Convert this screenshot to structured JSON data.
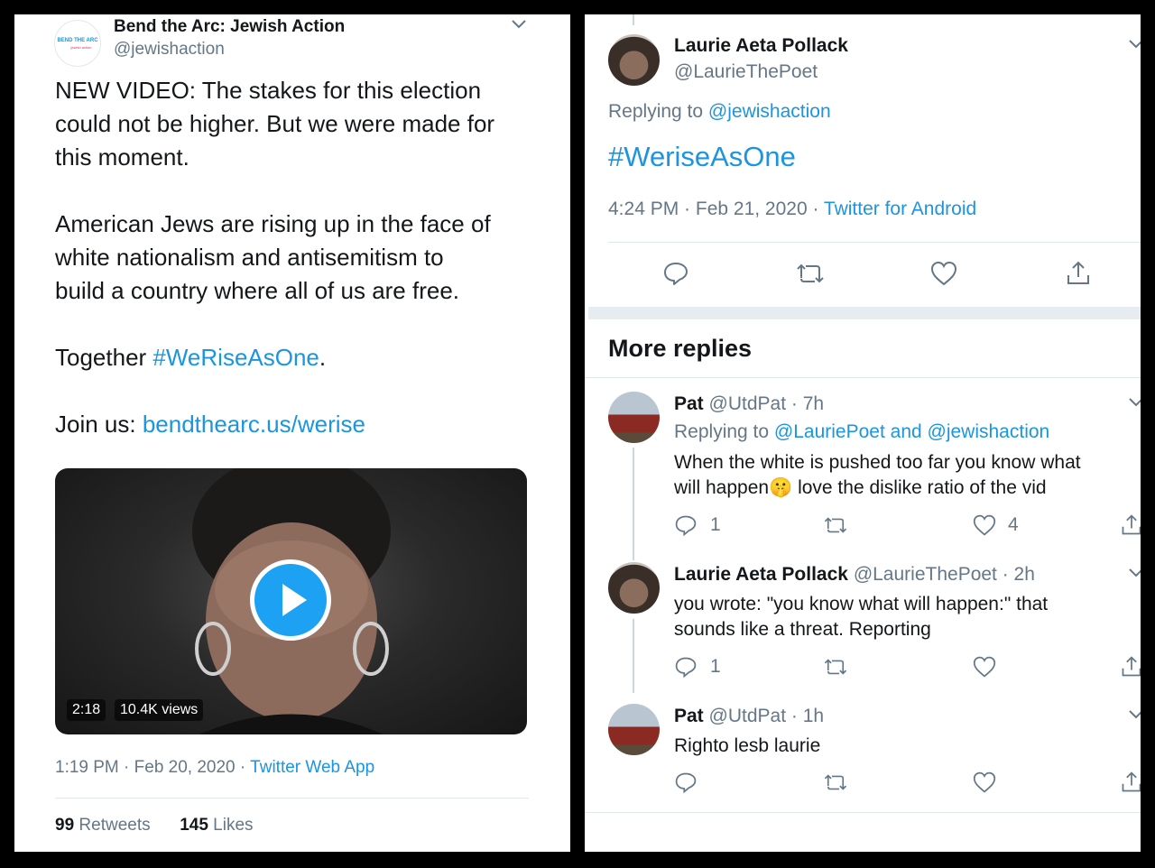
{
  "left_tweet": {
    "author_name": "Bend the Arc: Jewish Action",
    "author_handle": "@jewishaction",
    "avatar_logo_text": "BEND THE ARC",
    "avatar_logo_sub": "jewish action",
    "body_line1": "NEW VIDEO: The stakes for this election",
    "body_line2": "could not be higher. But we were made for",
    "body_line3": "this moment.",
    "body_line4": "American Jews are rising up in the face of",
    "body_line5": "white nationalism and antisemitism to",
    "body_line6": "build a country where all of us are free.",
    "together_text": "Together ",
    "hashtag": "#WeRiseAsOne",
    "period": ".",
    "join_text": "Join us: ",
    "join_link": "bendthearc.us/werise",
    "video_duration": "2:18",
    "video_views": "10.4K views",
    "timestamp": "1:19 PM · Feb 20, 2020 · ",
    "source": "Twitter Web App",
    "retweets_count": "99",
    "retweets_label": " Retweets",
    "likes_count": "145",
    "likes_label": " Likes"
  },
  "right_thread": {
    "main_reply": {
      "author_name": "Laurie Aeta Pollack",
      "author_handle": "@LaurieThePoet",
      "replying_to_label": "Replying to ",
      "replying_to_handle": "@jewishaction",
      "body_hashtag": "#WeriseAsOne",
      "timestamp": "4:24 PM · Feb 21, 2020 · ",
      "source": "Twitter for Android"
    },
    "more_replies_heading": "More replies",
    "replies": [
      {
        "author_name": "Pat",
        "meta": "@UtdPat · 7h",
        "replying_to_label": "Replying to ",
        "replying_to_handles": "@LauriePoet and @jewishaction",
        "body_line1": "When the white is pushed too far you know what",
        "body_line2a": "will happen",
        "emoji": "🤫",
        "body_line2b": " love the dislike ratio of the vid",
        "reply_count": "1",
        "like_count": "4"
      },
      {
        "author_name": "Laurie Aeta Pollack",
        "meta": "@LaurieThePoet · 2h",
        "body_line1": "you wrote: \"you know what will happen:\" that",
        "body_line2": "sounds like a threat.  Reporting",
        "reply_count": "1"
      },
      {
        "author_name": "Pat",
        "meta": "@UtdPat · 1h",
        "body_line1": "Righto lesb laurie"
      }
    ]
  },
  "colors": {
    "link": "#1b95e0",
    "secondary_text": "#657786",
    "icon": "#657786",
    "play_button": "#1da1f2",
    "frame": "#000000"
  }
}
